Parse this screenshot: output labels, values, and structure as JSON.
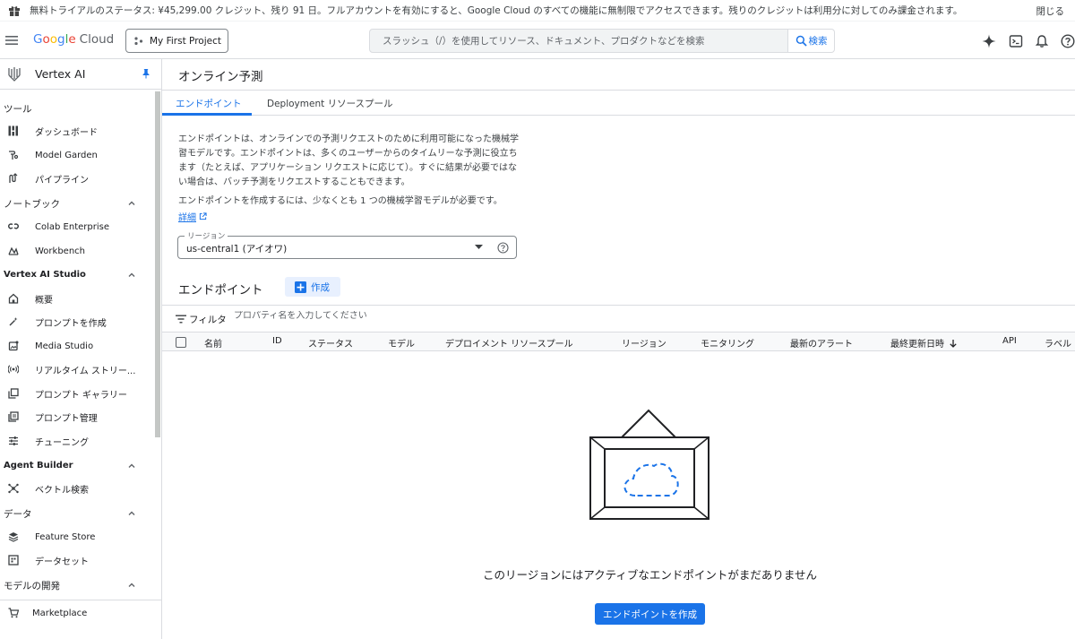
{
  "banner": {
    "text": "無料トライアルのステータス: ¥45,299.00 クレジット、残り 91 日。フルアカウントを有効にすると、Google Cloud のすべての機能に無制限でアクセスできます。残りのクレジットは利用分に対してのみ課金されます。",
    "close": "閉じる"
  },
  "header": {
    "logo_letters": [
      "G",
      "o",
      "o",
      "g",
      "l",
      "e"
    ],
    "logo_cloud": "Cloud",
    "project": "My First Project",
    "search_placeholder": "スラッシュ（/）を使用してリソース、ドキュメント、プロダクトなどを検索",
    "search_button": "検索"
  },
  "sidebar": {
    "title": "Vertex AI",
    "sections": {
      "tools": "ツール",
      "notebooks": "ノートブック",
      "studio": "Vertex AI Studio",
      "agent_builder": "Agent Builder",
      "data": "データ",
      "model_dev": "モデルの開発"
    },
    "items": {
      "dashboard": "ダッシュボード",
      "model_garden": "Model Garden",
      "pipeline": "パイプライン",
      "colab": "Colab Enterprise",
      "workbench": "Workbench",
      "overview": "概要",
      "create_prompt": "プロンプトを作成",
      "media_studio": "Media Studio",
      "realtime": "リアルタイム ストリー...",
      "prompt_gallery": "プロンプト ギャラリー",
      "prompt_manage": "プロンプト管理",
      "tuning": "チューニング",
      "vector_search": "ベクトル検索",
      "feature_store": "Feature Store",
      "dataset": "データセット",
      "marketplace": "Marketplace"
    }
  },
  "main": {
    "title": "オンライン予測",
    "tabs": [
      "エンドポイント",
      "Deployment リソースプール"
    ],
    "description": "エンドポイントは、オンラインでの予測リクエストのために利用可能になった機械学習モデルです。エンドポイントは、多くのユーザーからのタイムリーな予測に役立ちます（たとえば、アプリケーション リクエストに応じて）。すぐに結果が必要ではない場合は、バッチ予測をリクエストすることもできます。",
    "requirement": "エンドポイントを作成するには、少なくとも 1 つの機械学習モデルが必要です。",
    "details_link": "詳細",
    "region": {
      "label": "リージョン",
      "value": "us-central1 (アイオワ)"
    },
    "endpoints_title": "エンドポイント",
    "create_button": "作成",
    "filter": {
      "label": "フィルタ",
      "placeholder": "プロパティ名を入力してください"
    },
    "columns": [
      "名前",
      "ID",
      "ステータス",
      "モデル",
      "デプロイメント リソースプール",
      "リージョン",
      "モニタリング",
      "最新のアラート",
      "最終更新日時",
      "API",
      "ラベル"
    ],
    "empty_message": "このリージョンにはアクティブなエンドポイントがまだありません",
    "empty_button": "エンドポイントを作成"
  },
  "colors": {
    "accent": "#1a73e8",
    "primary_button": "#1a73e8",
    "create_bg": "#e8f0fe"
  }
}
